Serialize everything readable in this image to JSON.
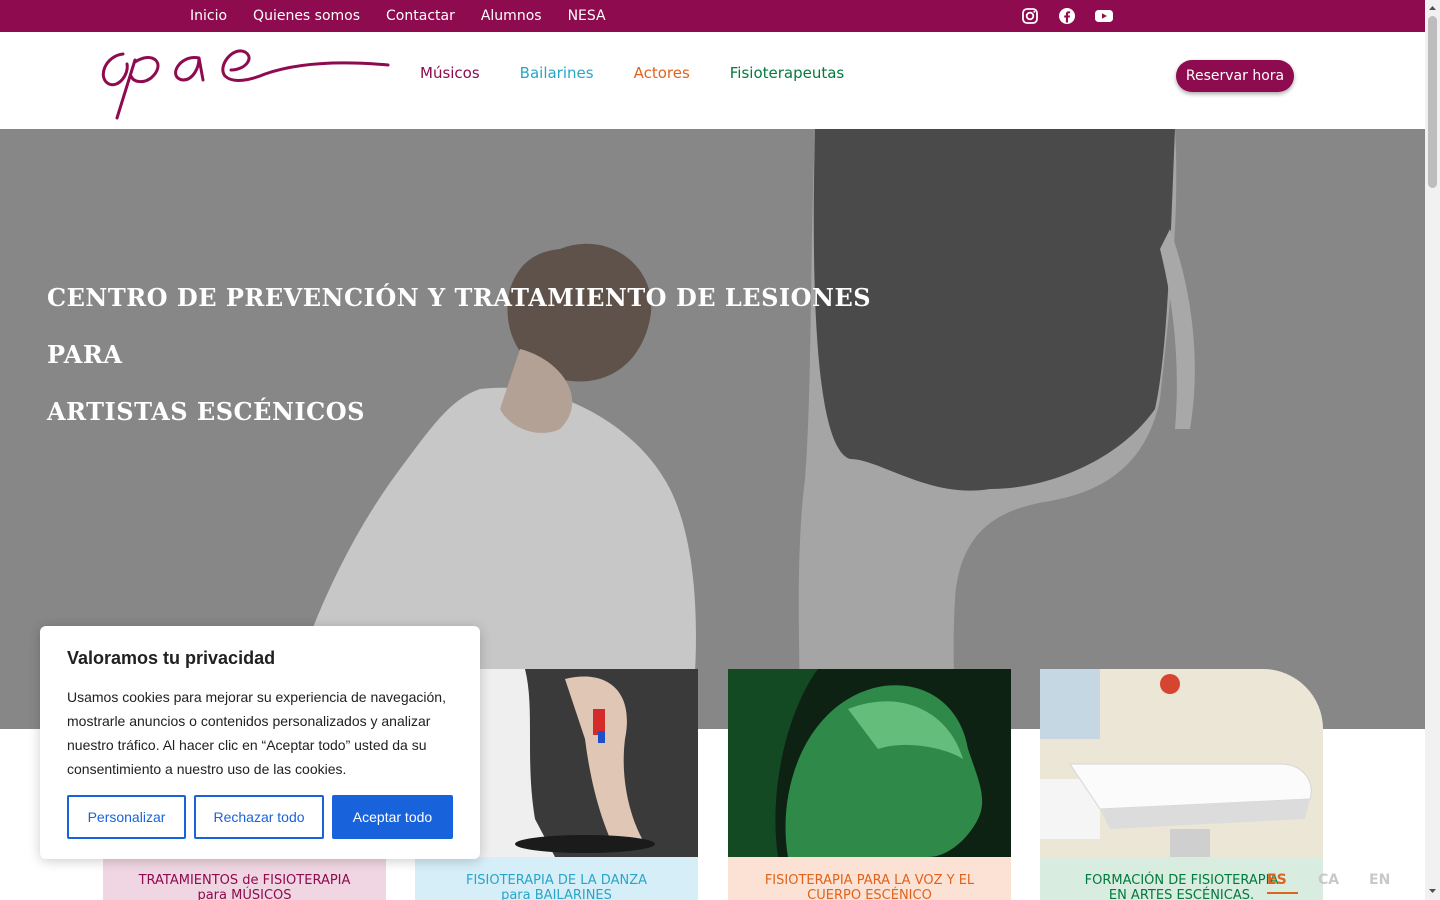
{
  "top_nav": {
    "items": [
      "Inicio",
      "Quienes somos",
      "Contactar",
      "Alumnos",
      "NESA"
    ]
  },
  "social": [
    "instagram-icon",
    "facebook-icon",
    "youtube-icon"
  ],
  "header": {
    "logo_text": "cpae",
    "nav": [
      {
        "label": "Músicos",
        "color": "#8e0b4f"
      },
      {
        "label": "Bailarines",
        "color": "#27a6c8"
      },
      {
        "label": "Actores",
        "color": "#e0631d"
      },
      {
        "label": "Fisioterapeutas",
        "color": "#007a3d"
      }
    ],
    "cta": "Reservar hora"
  },
  "hero": {
    "title_line1": "CENTRO DE PREVENCIÓN Y TRATAMIENTO DE LESIONES PARA",
    "title_line2": "ARTISTAS ESCÉNICOS"
  },
  "cards": [
    {
      "line1": "TRATAMIENTOS de FISIOTERAPIA",
      "line2": "para MÚSICOS",
      "text_color": "#8e0b4f",
      "bg_color": "#f0d6e2"
    },
    {
      "line1": "FISIOTERAPIA DE LA DANZA",
      "line2": "para BAILARINES",
      "text_color": "#27a6c8",
      "bg_color": "#d6eef7"
    },
    {
      "line1": "FISIOTERAPIA PARA LA VOZ Y EL",
      "line2": "CUERPO ESCÉNICO",
      "text_color": "#e0631d",
      "bg_color": "#fbe2d4"
    },
    {
      "line1": "FORMACIÓN DE FISIOTERAPIA",
      "line2": "EN ARTES ESCÉNICAS.",
      "text_color": "#007a3d",
      "bg_color": "#d8ecdf"
    }
  ],
  "cookie": {
    "title": "Valoramos tu privacidad",
    "body": "Usamos cookies para mejorar su experiencia de navegación, mostrarle anuncios o contenidos personalizados y analizar nuestro tráfico. Al hacer clic en “Aceptar todo” usted da su consentimiento a nuestro uso de las cookies.",
    "customize": "Personalizar",
    "reject": "Rechazar todo",
    "accept": "Aceptar todo",
    "accent": "#1863dc"
  },
  "languages": {
    "es": "ES",
    "ca": "CA",
    "en": "EN",
    "active_color": "#e0631d"
  }
}
